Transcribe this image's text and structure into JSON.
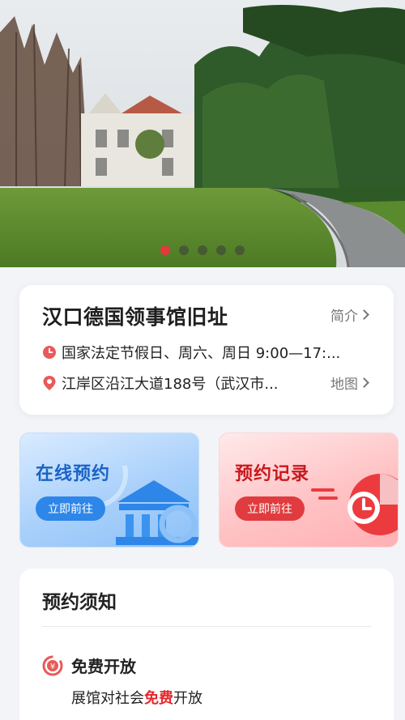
{
  "banner": {
    "slide_count": 5,
    "active_slide": 1
  },
  "venue": {
    "name": "汉口德国领事馆旧址",
    "intro_label": "简介",
    "hours": "国家法定节假日、周六、周日 9:00—17:...",
    "address": "江岸区沿江大道188号（武汉市...",
    "map_label": "地图"
  },
  "actions": {
    "book": {
      "title": "在线预约",
      "button": "立即前往"
    },
    "record": {
      "title": "预约记录",
      "button": "立即前往"
    }
  },
  "notice": {
    "title": "预约须知",
    "items": [
      {
        "title": "免费开放",
        "desc_prefix": "展馆对社会",
        "desc_highlight": "免费",
        "desc_suffix": "开放"
      }
    ]
  },
  "colors": {
    "accent_red": "#e23a3a",
    "accent_blue": "#2e86e8"
  }
}
